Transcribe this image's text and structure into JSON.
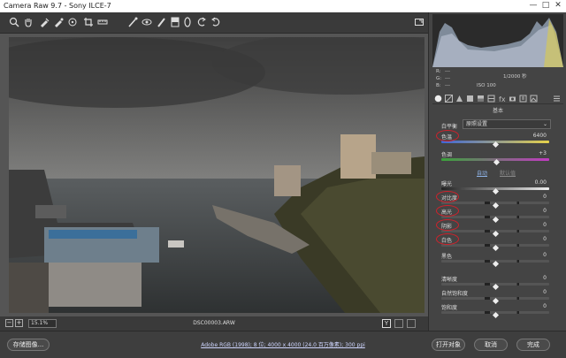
{
  "window": {
    "title": "Camera Raw 9.7 - Sony ILCE-7"
  },
  "exif": {
    "label_r": "R:",
    "label_g": "G:",
    "label_b": "B:",
    "dash": "---",
    "shutter": "1/2000 秒",
    "iso": "ISO 100"
  },
  "panel": {
    "section_title": "基本",
    "white_balance_label": "白平衡",
    "white_balance_value": "原照设置",
    "auto_link": "自动",
    "default_link": "默认值",
    "sliders": [
      {
        "label": "色温",
        "value": "6400",
        "level": 0.5,
        "highlighted": true
      },
      {
        "label": "色调",
        "value": "+3",
        "level": 0.51,
        "highlighted": false
      },
      {
        "label": "曝光",
        "value": "0.00",
        "level": 0.5,
        "highlighted": false
      },
      {
        "label": "对比度",
        "value": "0",
        "level": 0.5,
        "highlighted": true
      },
      {
        "label": "高光",
        "value": "0",
        "level": 0.5,
        "highlighted": true
      },
      {
        "label": "阴影",
        "value": "0",
        "level": 0.5,
        "highlighted": true
      },
      {
        "label": "白色",
        "value": "0",
        "level": 0.5,
        "highlighted": true
      },
      {
        "label": "黑色",
        "value": "0",
        "level": 0.5,
        "highlighted": false
      },
      {
        "label": "清晰度",
        "value": "0",
        "level": 0.5,
        "highlighted": false
      },
      {
        "label": "自然饱和度",
        "value": "0",
        "level": 0.5,
        "highlighted": false
      },
      {
        "label": "饱和度",
        "value": "0",
        "level": 0.5,
        "highlighted": false
      }
    ]
  },
  "status": {
    "zoom": "15.1%",
    "filename": "DSC00003.ARW",
    "view_label": "Y"
  },
  "footer": {
    "save_button": "存储图像...",
    "info_link": "Adobe RGB (1998); 8 位; 4000 x 4000 (24.0 百万像素); 300 ppi",
    "open_button": "打开对象",
    "cancel_button": "取消",
    "done_button": "完成"
  },
  "colors": {
    "highlight_oval": "#d0222c",
    "temp_track_start": "#3f66d6",
    "temp_track_end": "#e6d24a",
    "tint_track_start": "#3aa23a",
    "tint_track_end": "#c23ac2"
  },
  "icons": [
    "zoom-icon",
    "hand-icon",
    "white-balance-icon",
    "color-sampler-icon",
    "targeted-adjust-icon",
    "crop-icon",
    "straighten-icon",
    "spot-removal-icon",
    "red-eye-icon",
    "adjustment-brush-icon",
    "graduated-filter-icon",
    "radial-filter-icon",
    "rotate-left-icon",
    "rotate-right-icon"
  ]
}
